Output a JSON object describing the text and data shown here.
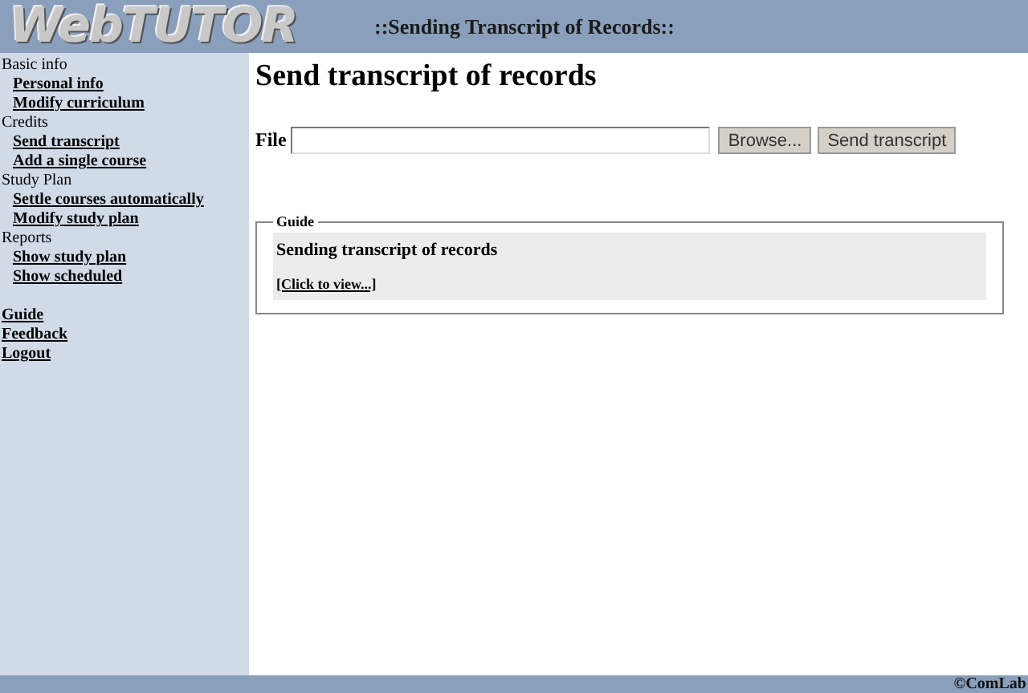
{
  "header": {
    "logo": "WebTUTOR",
    "title": "::Sending Transcript of Records::"
  },
  "sidebar": {
    "sections": [
      {
        "heading": "Basic info",
        "links": [
          "Personal info",
          "Modify curriculum"
        ]
      },
      {
        "heading": "Credits",
        "links": [
          "Send transcript",
          "Add a single course"
        ]
      },
      {
        "heading": "Study Plan",
        "links": [
          "Settle courses automatically",
          "Modify study plan"
        ]
      },
      {
        "heading": "Reports",
        "links": [
          "Show study plan",
          "Show scheduled"
        ]
      }
    ],
    "bottom_links": [
      "Guide",
      "Feedback",
      "Logout"
    ]
  },
  "main": {
    "heading": "Send transcript of records",
    "file_label": "File",
    "browse_button": "Browse...",
    "send_button": "Send transcript",
    "guide": {
      "legend": "Guide",
      "title": "Sending transcript of records",
      "link": "[Click to view...]"
    }
  },
  "footer": {
    "text": "©ComLab"
  }
}
